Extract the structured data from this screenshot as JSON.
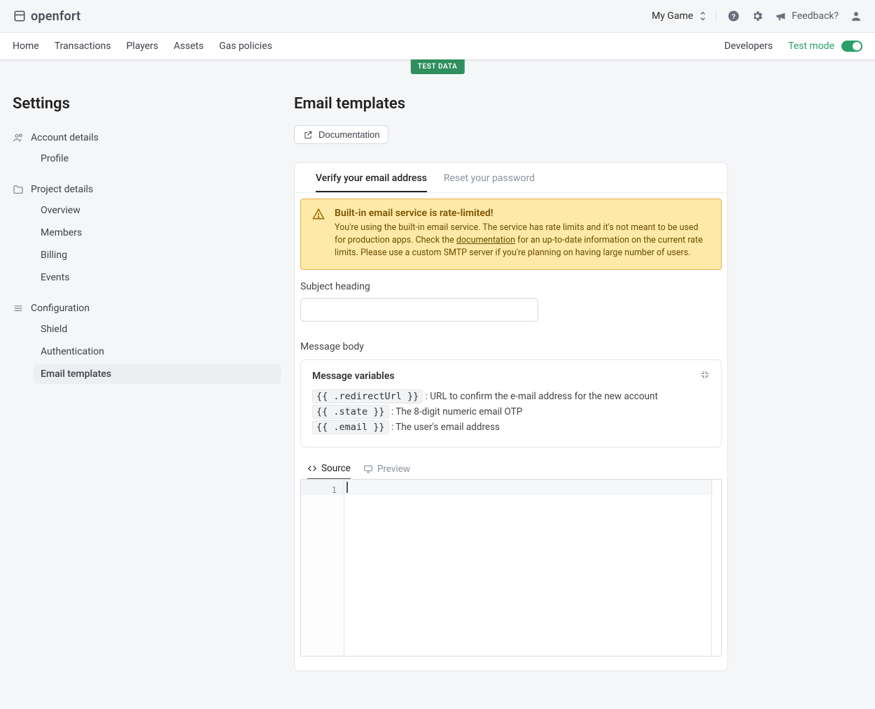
{
  "brand": {
    "name": "openfort"
  },
  "topbar": {
    "project": "My Game",
    "feedback": "Feedback?"
  },
  "nav": {
    "items": [
      "Home",
      "Transactions",
      "Players",
      "Assets",
      "Gas policies"
    ],
    "developers": "Developers",
    "testmode": "Test mode"
  },
  "ribbon": "TEST DATA",
  "sidebar": {
    "title": "Settings",
    "groups": [
      {
        "head": "Account details",
        "items": [
          "Profile"
        ]
      },
      {
        "head": "Project details",
        "items": [
          "Overview",
          "Members",
          "Billing",
          "Events"
        ]
      },
      {
        "head": "Configuration",
        "items": [
          "Shield",
          "Authentication",
          "Email templates"
        ]
      }
    ],
    "active": "Email templates"
  },
  "page": {
    "title": "Email templates",
    "doc_btn": "Documentation"
  },
  "tabs": {
    "verify": "Verify your email address",
    "reset": "Reset your password"
  },
  "alert": {
    "title": "Built-in email service is rate-limited!",
    "pre": "You're using the built-in email service. The service has rate limits and it's not meant to be used for production apps. Check the ",
    "link": "documentation",
    "post": " for an up-to-date information on the current rate limits. Please use a custom SMTP server if you're planning on having large number of users."
  },
  "fields": {
    "subject_label": "Subject heading",
    "subject_value": "",
    "body_label": "Message body"
  },
  "vars": {
    "title": "Message variables",
    "rows": [
      {
        "code": "{{ .redirectUrl }}",
        "desc": ": URL to confirm the e-mail address for the new account"
      },
      {
        "code": "{{ .state }}",
        "desc": ": The 8-digit numeric email OTP"
      },
      {
        "code": "{{ .email }}",
        "desc": ": The user's email address"
      }
    ]
  },
  "editor": {
    "tabs": {
      "source": "Source",
      "preview": "Preview"
    },
    "line_number": "1"
  }
}
